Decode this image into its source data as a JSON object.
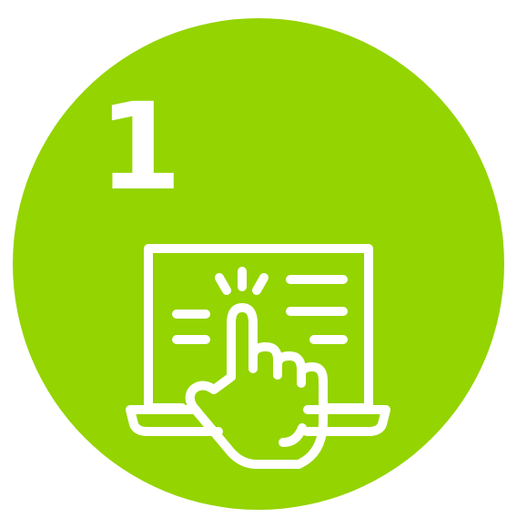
{
  "badge": {
    "number": "1",
    "icon": "laptop-touch-icon",
    "colors": {
      "background": "#94d400",
      "foreground": "#ffffff"
    }
  }
}
